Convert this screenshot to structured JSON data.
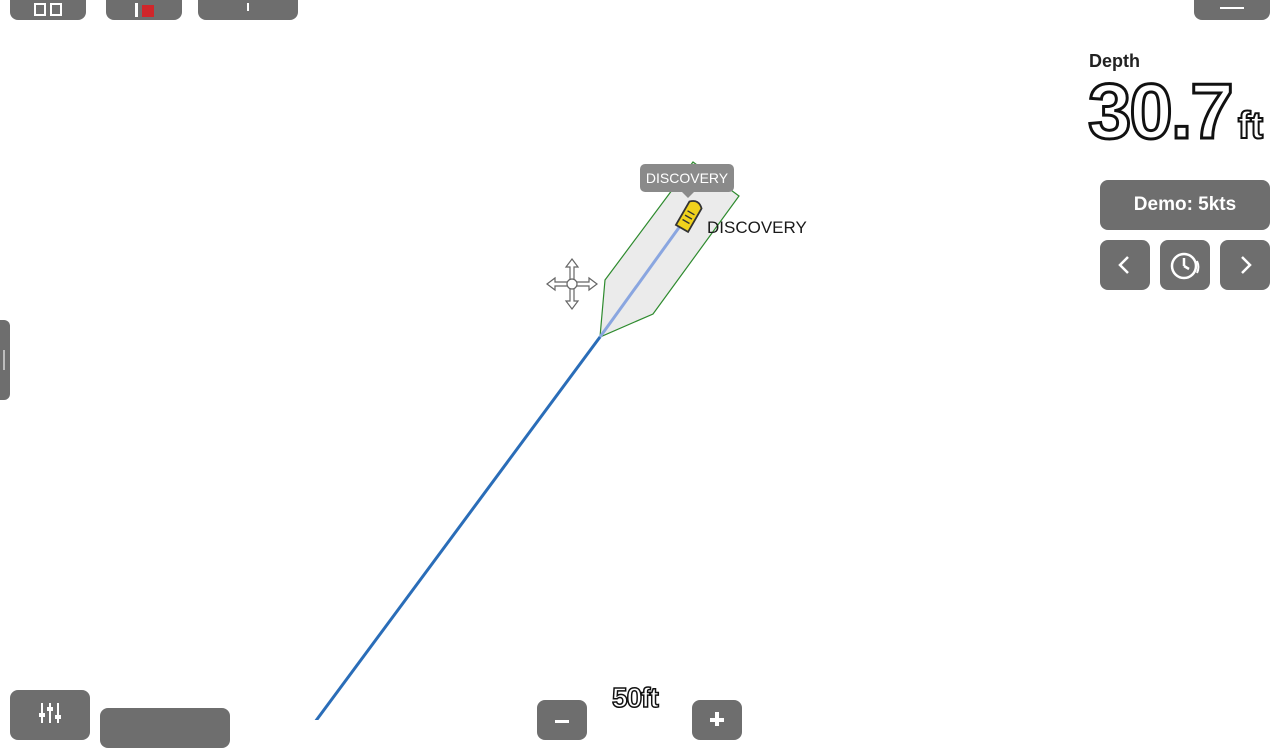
{
  "depth": {
    "label": "Depth",
    "value": "30.7",
    "unit": "ft"
  },
  "demo": {
    "label": "Demo: 5kts"
  },
  "vessel": {
    "tooltip": "DISCOVERY",
    "name": "DISCOVERY"
  },
  "scale": {
    "label": "50ft"
  },
  "colors": {
    "track": "#2a6db8",
    "vessel_icon": "#f0d21c",
    "guard_zone_stroke": "#2e8b2e",
    "button_bg": "#6e6e6e"
  },
  "icons": {
    "layout": "layout-grid-icon",
    "radar": "radar-icon",
    "pointer": "pointer-icon",
    "menu": "hamburger-menu-icon",
    "prev": "chevron-left-icon",
    "clock": "timer-icon",
    "next": "chevron-right-icon",
    "settings": "sliders-icon",
    "zoom_out": "minus-icon",
    "zoom_in": "plus-icon",
    "cursor": "move-cursor-icon",
    "vessel": "boat-icon"
  }
}
